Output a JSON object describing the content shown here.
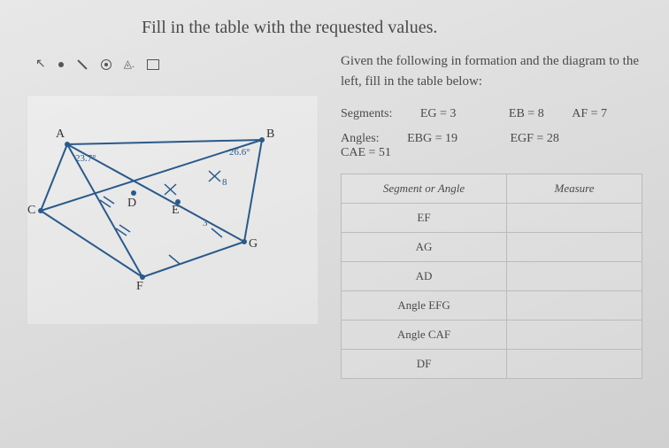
{
  "title": "Fill in the table with the requested values.",
  "instructions": "Given the following in formation and the diagram to the left, fill in the table below:",
  "segments_label": "Segments:",
  "angles_label": "Angles:",
  "given_segments": {
    "eg": "EG = 3",
    "eb": "EB = 8",
    "af": "AF = 7"
  },
  "given_angles": {
    "ebg": "EBG = 19",
    "egf": "EGF = 28",
    "cae": "CAE = 51"
  },
  "diagram": {
    "vertices": {
      "A": "A",
      "B": "B",
      "C": "C",
      "D": "D",
      "E": "E",
      "F": "F",
      "G": "G"
    },
    "angle_A": "23.7°",
    "angle_B": "26.6°",
    "seg_EB": "8",
    "seg_EG": "3"
  },
  "table": {
    "header_left": "Segment or Angle",
    "header_right": "Measure",
    "rows": [
      "EF",
      "AG",
      "AD",
      "Angle EFG",
      "Angle CAF",
      "DF"
    ]
  },
  "chart_data": {
    "type": "table",
    "title": "Fill in the table with the requested values.",
    "given": {
      "segments": {
        "EG": 3,
        "EB": 8,
        "AF": 7
      },
      "angles": {
        "EBG": 19,
        "EGF": 28,
        "CAE": 51
      },
      "diagram_angles": {
        "A": 23.7,
        "B": 26.6
      }
    },
    "columns": [
      "Segment or Angle",
      "Measure"
    ],
    "rows": [
      {
        "item": "EF",
        "measure": null
      },
      {
        "item": "AG",
        "measure": null
      },
      {
        "item": "AD",
        "measure": null
      },
      {
        "item": "Angle EFG",
        "measure": null
      },
      {
        "item": "Angle CAF",
        "measure": null
      },
      {
        "item": "DF",
        "measure": null
      }
    ]
  }
}
